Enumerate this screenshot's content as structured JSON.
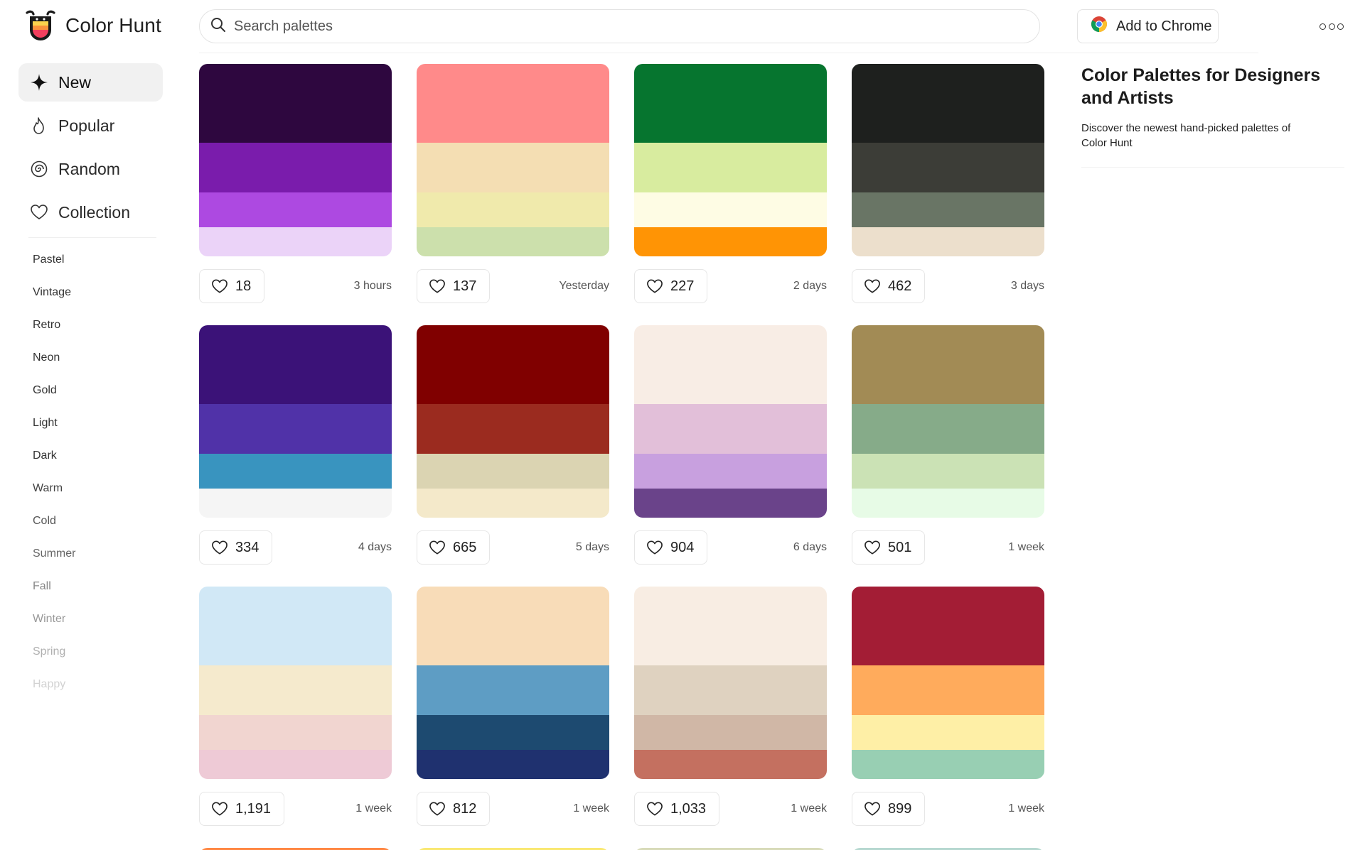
{
  "header": {
    "brand": "Color Hunt",
    "search_placeholder": "Search palettes",
    "chrome_label": "Add to Chrome"
  },
  "nav": [
    {
      "label": "New",
      "icon": "sparkle-icon"
    },
    {
      "label": "Popular",
      "icon": "flame-icon"
    },
    {
      "label": "Random",
      "icon": "spiral-icon"
    },
    {
      "label": "Collection",
      "icon": "heart-icon"
    }
  ],
  "tags": [
    "Pastel",
    "Vintage",
    "Retro",
    "Neon",
    "Gold",
    "Light",
    "Dark",
    "Warm",
    "Cold",
    "Summer",
    "Fall",
    "Winter",
    "Spring",
    "Happy"
  ],
  "palettes": [
    {
      "colors": [
        "#2E073F",
        "#7A1CAC",
        "#AD49E1",
        "#EBD3F8"
      ],
      "likes": "18",
      "time": "3 hours"
    },
    {
      "colors": [
        "#FF8A8A",
        "#F4DEB3",
        "#F0EAAC",
        "#CCE0AC"
      ],
      "likes": "137",
      "time": "Yesterday"
    },
    {
      "colors": [
        "#06752F",
        "#D8EC9F",
        "#FEFCE4",
        "#FF9405"
      ],
      "likes": "227",
      "time": "2 days"
    },
    {
      "colors": [
        "#1E201E",
        "#3C3D37",
        "#697565",
        "#ECDFCC"
      ],
      "likes": "462",
      "time": "3 days"
    },
    {
      "colors": [
        "#3B1278",
        "#5032A8",
        "#3994BF",
        "#F5F5F5"
      ],
      "likes": "334",
      "time": "4 days"
    },
    {
      "colors": [
        "#800000",
        "#9B2B1F",
        "#DBD4B2",
        "#F4E9CA"
      ],
      "likes": "665",
      "time": "5 days"
    },
    {
      "colors": [
        "#F8EDE5",
        "#E2BFD9",
        "#C8A0DF",
        "#6A438A"
      ],
      "likes": "904",
      "time": "6 days"
    },
    {
      "colors": [
        "#A28B55",
        "#86AB89",
        "#CBE2B5",
        "#E7FBE6"
      ],
      "likes": "501",
      "time": "1 week"
    },
    {
      "colors": [
        "#D1E8F6",
        "#F5EACD",
        "#F1D5D0",
        "#EECAD6"
      ],
      "likes": "1,191",
      "time": "1 week"
    },
    {
      "colors": [
        "#F8DCB8",
        "#5E9DC4",
        "#1D4A70",
        "#1F316F"
      ],
      "likes": "812",
      "time": "1 week"
    },
    {
      "colors": [
        "#F8EDE3",
        "#DFD2C0",
        "#D0B7A6",
        "#C47060"
      ],
      "likes": "1,033",
      "time": "1 week"
    },
    {
      "colors": [
        "#A31D35",
        "#FFAB5C",
        "#FEEFA6",
        "#98CFB3"
      ],
      "likes": "899",
      "time": "1 week"
    }
  ],
  "partial_row_colors": [
    "#FF8743",
    "#F9E871",
    "#D8DBB9",
    "#B6D8D0"
  ],
  "tag_colors": [
    "#333333",
    "#333333",
    "#333333",
    "#333333",
    "#333333",
    "#333333",
    "#333333",
    "#444444",
    "#555555",
    "#666666",
    "#888888",
    "#999999",
    "#b0b0b0",
    "#d2d2d2"
  ],
  "about": {
    "title": "Color Palettes for Designers and Artists",
    "description": "Discover the newest hand-picked palettes of Color Hunt"
  }
}
